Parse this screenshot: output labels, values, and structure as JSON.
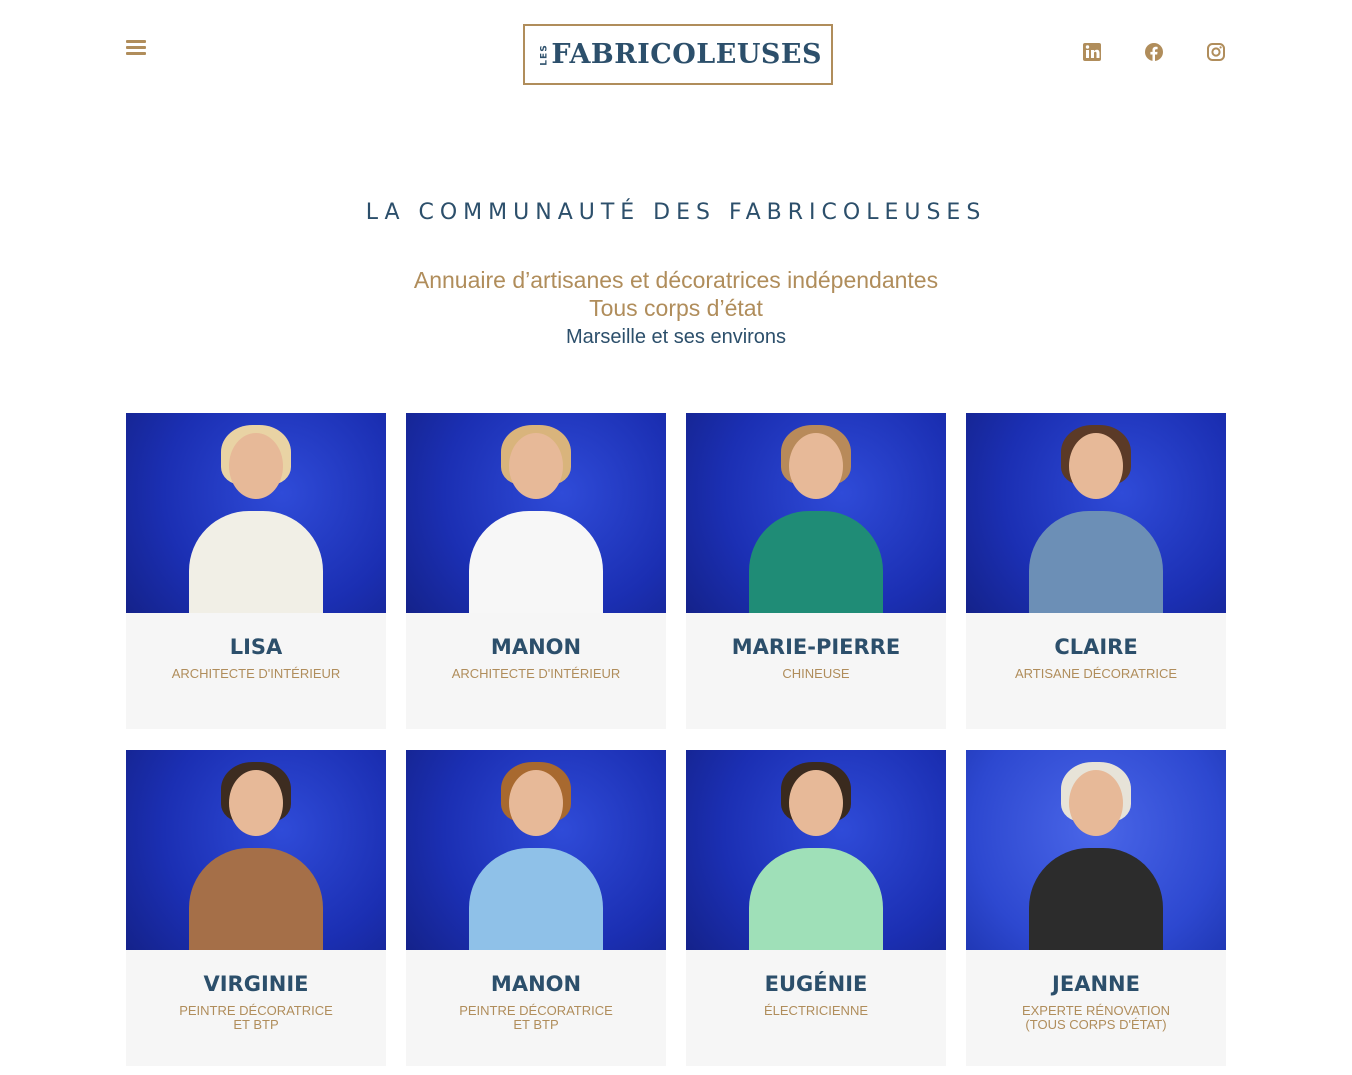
{
  "header": {
    "logo_prefix": "LES",
    "logo_text": "FABRICOLEUSES",
    "menu_icon": "hamburger-icon",
    "socials": [
      {
        "name": "linkedin",
        "icon": "linkedin-icon"
      },
      {
        "name": "facebook",
        "icon": "facebook-icon"
      },
      {
        "name": "instagram",
        "icon": "instagram-icon"
      }
    ]
  },
  "main": {
    "title": "LA COMMUNAUTÉ DES FABRICOLEUSES",
    "subtitle_line1": "Annuaire d’artisanes et décoratrices indépendantes",
    "subtitle_line2": "Tous corps d’état",
    "subtitle_line3": "Marseille et ses environs"
  },
  "members": [
    {
      "name": "LISA",
      "role": "ARCHITECTE D'INTÉRIEUR",
      "hair": "#e9d3a4",
      "top": "#f1efe6"
    },
    {
      "name": "MANON",
      "role": "ARCHITECTE D'INTÉRIEUR",
      "hair": "#d9b47c",
      "top": "#f7f7f7"
    },
    {
      "name": "MARIE-PIERRE",
      "role": "CHINEUSE",
      "hair": "#b88a5a",
      "top": "#1f8c76"
    },
    {
      "name": "CLAIRE",
      "role": "ARTISANE DÉCORATRICE",
      "hair": "#5b3a27",
      "top": "#6c8fb6"
    },
    {
      "name": "VIRGINIE",
      "role": "PEINTRE DÉCORATRICE\nET BTP",
      "hair": "#3d2c20",
      "top": "#a56f48"
    },
    {
      "name": "MANON",
      "role": "PEINTRE DÉCORATRICE\nET BTP",
      "hair": "#a8692f",
      "top": "#8fc1e8"
    },
    {
      "name": "EUGÉNIE",
      "role": "ÉLECTRICIENNE",
      "hair": "#3a2a1e",
      "top": "#9fe0b8"
    },
    {
      "name": "JEANNE",
      "role": "EXPERTE RÉNOVATION\n(TOUS CORPS D'ÉTAT)",
      "hair": "#e7e3d8",
      "top": "#2c2c2c"
    }
  ],
  "colors": {
    "accent": "#b08d5b",
    "brand": "#2c4f6b",
    "photo_bg": "#1b2fb3"
  }
}
